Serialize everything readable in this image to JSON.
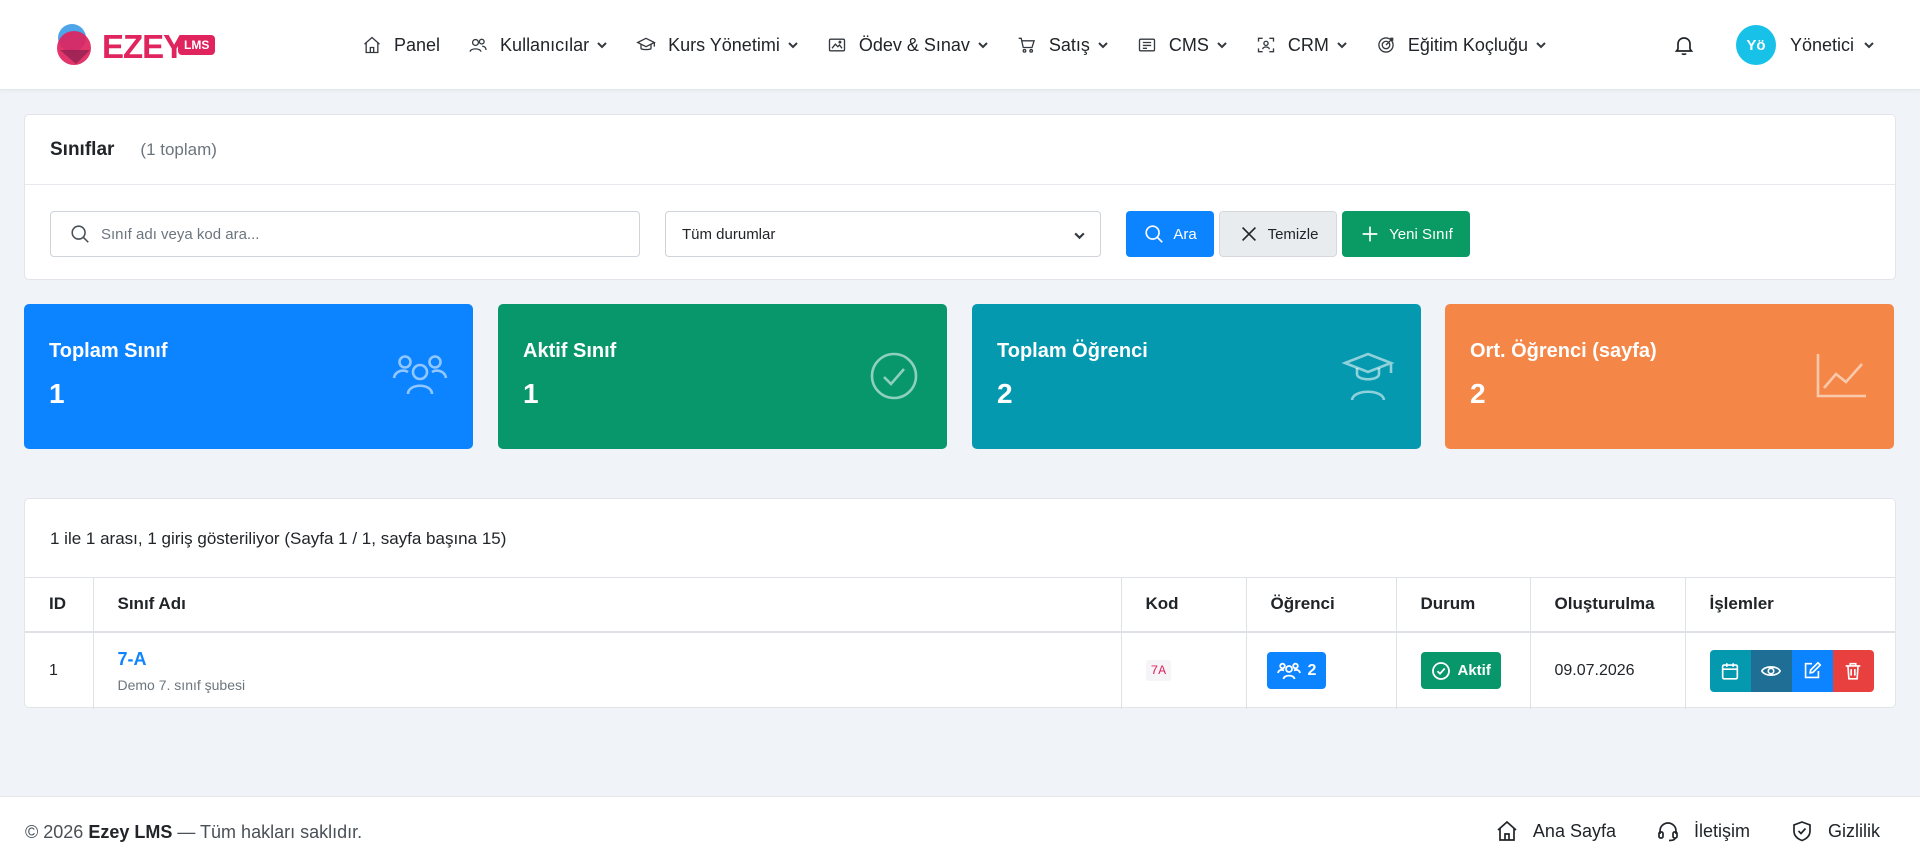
{
  "brand": {
    "name": "EZEY",
    "badge": "LMS",
    "colors": {
      "primary": "#e0245e",
      "blue": "#0d84ff",
      "green": "#07976a",
      "teal": "#0599b0",
      "orange": "#f48748"
    }
  },
  "nav": {
    "items": [
      {
        "label": "Panel",
        "icon": "home-icon",
        "dropdown": false
      },
      {
        "label": "Kullanıcılar",
        "icon": "users-icon",
        "dropdown": true
      },
      {
        "label": "Kurs Yönetimi",
        "icon": "graduation-cap-icon",
        "dropdown": true
      },
      {
        "label": "Ödev & Sınav",
        "icon": "image-icon",
        "dropdown": true
      },
      {
        "label": "Satış",
        "icon": "cart-icon",
        "dropdown": true
      },
      {
        "label": "CMS",
        "icon": "layout-icon",
        "dropdown": true
      },
      {
        "label": "CRM",
        "icon": "scan-user-icon",
        "dropdown": true
      },
      {
        "label": "Eğitim Koçluğu",
        "icon": "target-icon",
        "dropdown": true
      }
    ],
    "user": {
      "initials": "Yö",
      "name": "Yönetici"
    }
  },
  "filter": {
    "title": "Sınıflar",
    "count": "(1 toplam)",
    "search_placeholder": "Sınıf adı veya kod ara...",
    "status_selected": "Tüm durumlar",
    "search_button": "Ara",
    "clear_button": "Temizle",
    "new_button": "Yeni Sınıf"
  },
  "stats": [
    {
      "label": "Toplam Sınıf",
      "value": "1",
      "icon": "users-icon"
    },
    {
      "label": "Aktif Sınıf",
      "value": "1",
      "icon": "check-circle-icon"
    },
    {
      "label": "Toplam Öğrenci",
      "value": "2",
      "icon": "student-icon"
    },
    {
      "label": "Ort. Öğrenci (sayfa)",
      "value": "2",
      "icon": "chart-line-icon"
    }
  ],
  "table": {
    "info": "1 ile 1 arası, 1 giriş gösteriliyor (Sayfa 1 / 1, sayfa başına 15)",
    "headers": [
      "ID",
      "Sınıf Adı",
      "Kod",
      "Öğrenci",
      "Durum",
      "Oluşturulma",
      "İşlemler"
    ],
    "rows": [
      {
        "id": "1",
        "name": "7-A",
        "desc": "Demo 7. sınıf şubesi",
        "code": "7A",
        "students": "2",
        "status": "Aktif",
        "created": "09.07.2026"
      }
    ]
  },
  "footer": {
    "year": "© 2026",
    "company": "Ezey LMS",
    "rights": "— Tüm hakları saklıdır.",
    "links": [
      "Ana Sayfa",
      "İletişim",
      "Gizlilik"
    ]
  }
}
